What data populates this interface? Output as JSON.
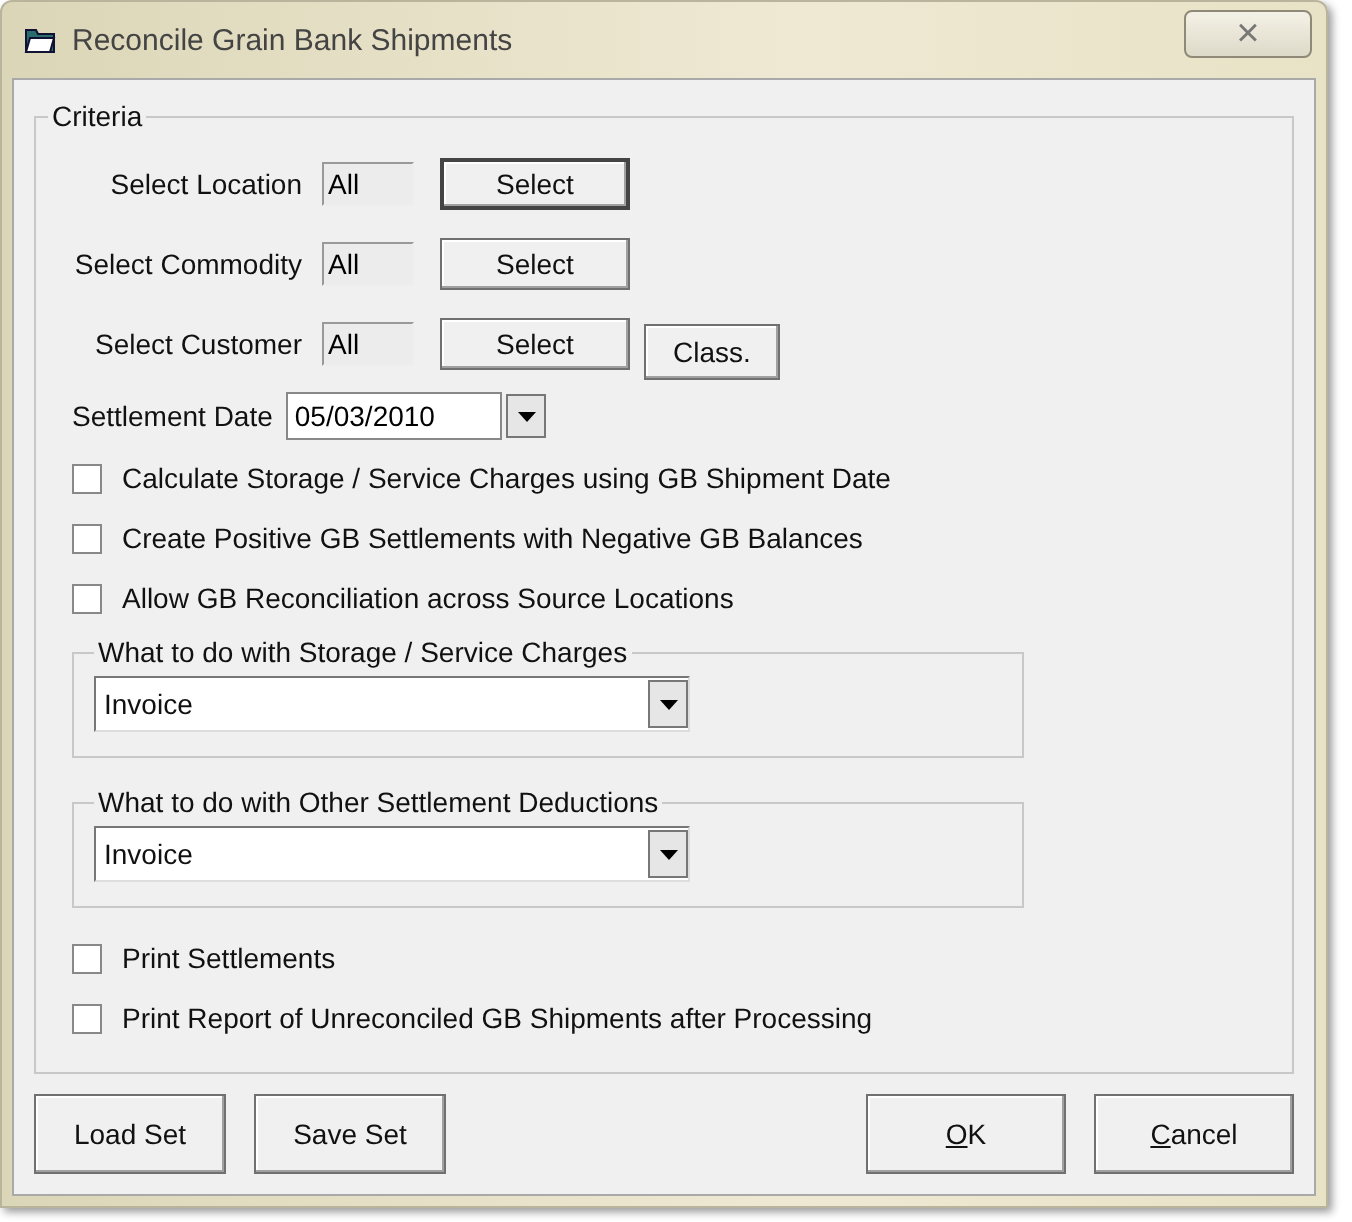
{
  "window": {
    "title": "Reconcile Grain Bank Shipments",
    "close": "×"
  },
  "criteria": {
    "title": "Criteria",
    "selectors": [
      {
        "label": "Select Location",
        "value": "All",
        "button": "Select",
        "focused": true
      },
      {
        "label": "Select Commodity",
        "value": "All",
        "button": "Select",
        "focused": false
      },
      {
        "label": "Select Customer",
        "value": "All",
        "button": "Select",
        "focused": false,
        "extra_button": "Class."
      }
    ],
    "settlement_date": {
      "label": "Settlement Date",
      "value": "05/03/2010"
    },
    "options": [
      {
        "label": "Calculate Storage / Service Charges using GB Shipment Date",
        "checked": false
      },
      {
        "label": "Create Positive GB Settlements with Negative GB Balances",
        "checked": false
      },
      {
        "label": "Allow GB Reconciliation across Source Locations",
        "checked": false
      }
    ],
    "groups": [
      {
        "title": "What to do with Storage / Service Charges",
        "value": "Invoice"
      },
      {
        "title": "What to do with Other Settlement Deductions",
        "value": "Invoice"
      }
    ],
    "print_options": [
      {
        "label": "Print Settlements",
        "checked": false
      },
      {
        "label": "Print Report of Unreconciled GB Shipments after Processing",
        "checked": false
      }
    ]
  },
  "left_buttons": [
    {
      "label": "Load Set",
      "underline_first": false
    },
    {
      "label": "Save Set",
      "underline_first": false
    }
  ],
  "right_buttons": [
    {
      "label": "OK",
      "underline_first": true
    },
    {
      "label": "Cancel",
      "underline_first": true
    }
  ]
}
